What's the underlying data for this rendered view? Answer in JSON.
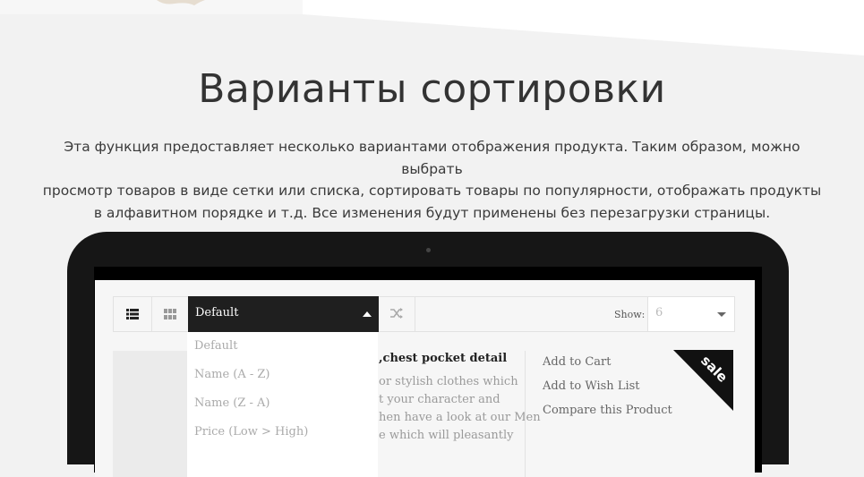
{
  "section": {
    "title": "Варианты сортировки",
    "desc_line1": "Эта функция предоставляет несколько вариантами отображения продукта. Таким образом, можно выбрать",
    "desc_line2": "просмотр товаров в виде сетки или списка, сортировать товары по популярности, отображать продукты",
    "desc_line3": "в алфавитном порядке и т.д. Все изменения будут применены без перезагрузки страницы."
  },
  "toolbar": {
    "sort_value": "Default",
    "show_label": "Show:",
    "show_value": "6"
  },
  "sort_options": [
    "Default",
    "Name (A - Z)",
    "Name (Z - A)",
    "Price (Low > High)"
  ],
  "product": {
    "title": ",chest pocket detail",
    "desc_lines": [
      "or stylish clothes which",
      "t your character and",
      "hen have a look at our Men",
      "e which will pleasantly"
    ]
  },
  "actions": {
    "add_to_cart": "Add to Cart",
    "add_to_wishlist": "Add to Wish List",
    "compare": "Compare this Product"
  },
  "badge": {
    "sale": "sale"
  },
  "icons": {
    "list": "list-view-icon",
    "grid": "grid-view-icon",
    "shuffle": "shuffle-icon"
  },
  "colors": {
    "accent_dark": "#1f1f1f",
    "page_bg": "#f2f2f2"
  }
}
